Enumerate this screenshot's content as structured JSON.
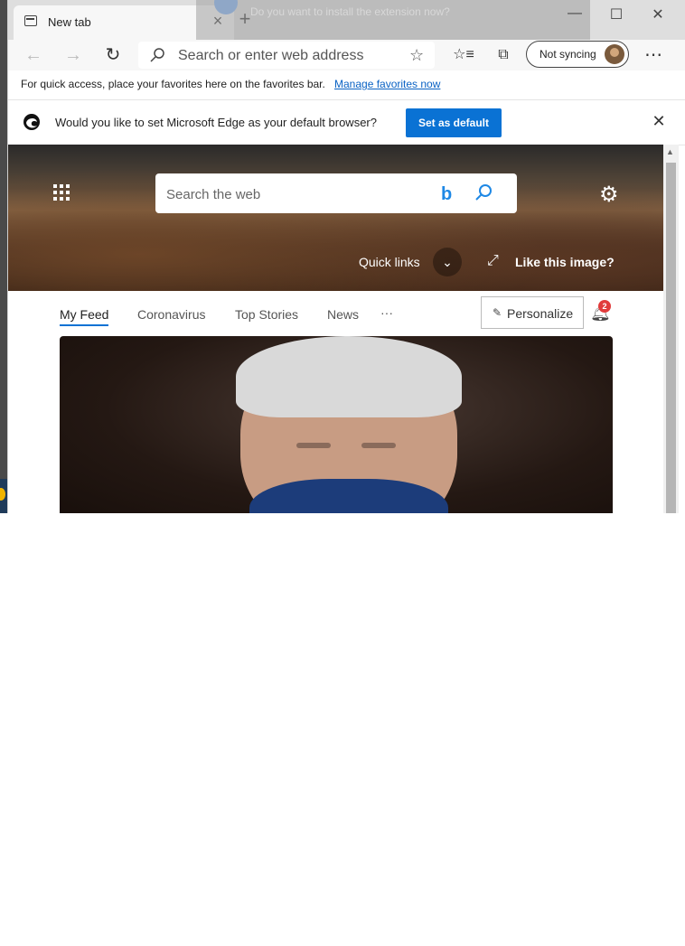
{
  "window": {
    "tab_title": "New tab",
    "overlay_prompt": "Do you want to install the extension now?"
  },
  "toolbar": {
    "address_placeholder": "Search or enter web address",
    "sync_label": "Not syncing"
  },
  "favorites_bar": {
    "text": "For quick access, place your favorites here on the favorites bar.",
    "link": "Manage favorites now"
  },
  "default_bar": {
    "question": "Would you like to set Microsoft Edge as your default browser?",
    "button": "Set as default"
  },
  "hero": {
    "search_placeholder": "Search the web",
    "quick_links": "Quick links",
    "like_image": "Like this image?"
  },
  "feed": {
    "tabs": [
      "My Feed",
      "Coronavirus",
      "Top Stories",
      "News"
    ],
    "more": "···",
    "personalize": "Personalize",
    "notification_count": "2"
  },
  "colors": {
    "accent": "#0a72d4",
    "link": "#0a62c4",
    "badge": "#e13b3b"
  }
}
